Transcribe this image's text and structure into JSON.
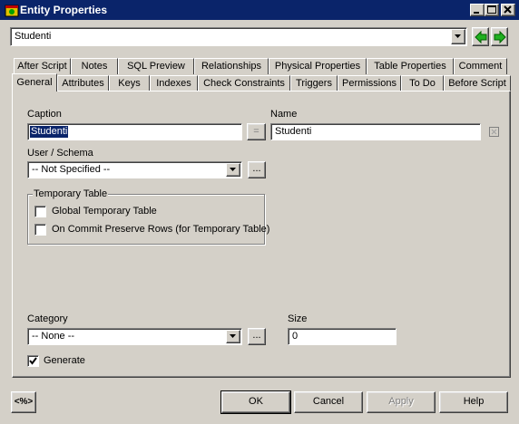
{
  "window": {
    "title": "Entity Properties"
  },
  "header": {
    "entity_combo_value": "Studenti"
  },
  "tabs_row1": [
    "After Script",
    "Notes",
    "SQL Preview",
    "Relationships",
    "Physical Properties",
    "Table Properties",
    "Comment"
  ],
  "tabs_row2": [
    "General",
    "Attributes",
    "Keys",
    "Indexes",
    "Check Constraints",
    "Triggers",
    "Permissions",
    "To Do",
    "Before Script"
  ],
  "general": {
    "caption_label": "Caption",
    "caption_value": "Studenti",
    "equals_button": "=",
    "name_label": "Name",
    "name_value": "Studenti",
    "user_schema_label": "User / Schema",
    "user_schema_value": "-- Not Specified --",
    "ellipsis": "...",
    "temp_table_label": "Temporary Table",
    "global_temp_label": "Global Temporary Table",
    "on_commit_label": "On Commit Preserve Rows (for Temporary Table)",
    "category_label": "Category",
    "category_value": "-- None --",
    "size_label": "Size",
    "size_value": "0",
    "generate_label": "Generate"
  },
  "footer": {
    "macro_button": "<%>",
    "ok": "OK",
    "cancel": "Cancel",
    "apply": "Apply",
    "help": "Help"
  }
}
